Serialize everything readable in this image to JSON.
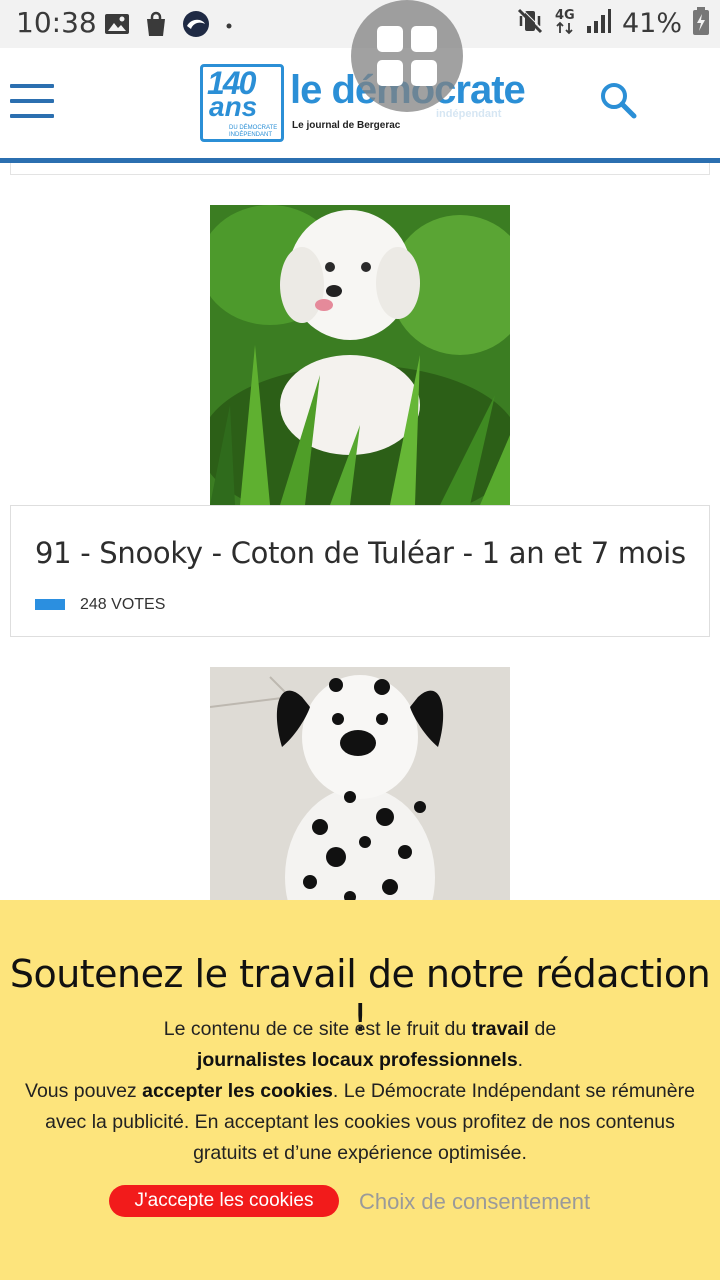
{
  "status_bar": {
    "time": "10:38",
    "battery_percent": "41%",
    "icons_left": [
      "image-icon",
      "shopping-bag-icon",
      "app-swirl-icon",
      "dot-icon"
    ],
    "icons_right": [
      "mute-vibrate-icon",
      "4g-icon",
      "signal-icon",
      "battery-charging-icon"
    ]
  },
  "header": {
    "logo_badge_number": "140",
    "logo_badge_word": "ans",
    "logo_badge_small": "DU DÉMOCRATE INDÉPENDANT",
    "logo_title": "le démocrate",
    "logo_subtitle": "Le journal de Bergerac",
    "logo_watermark": "indépendant",
    "accent_color": "#2b6fb0"
  },
  "entries": [
    {
      "title": "91 - Snooky - Coton de Tuléar - 1 an et 7 mois",
      "votes": "248 VOTES"
    }
  ],
  "cookie_banner": {
    "heading": "Soutenez le travail de notre rédaction !",
    "line1_a": "Le contenu de ce site est le fruit du ",
    "line1_b": "travail",
    "line1_c": " de",
    "line2_b": "journalistes locaux professionnels",
    "line2_c": ".",
    "line3_a": "Vous pouvez ",
    "line3_b": "accepter les cookies",
    "line3_c": ". Le Démocrate Indépendant se rémunère avec la publicité. En acceptant les cookies vous profitez de nos contenus gratuits et d’une expérience optimisée.",
    "accept_label": "J'accepte les cookies",
    "choice_label": "Choix de consentement",
    "background_color": "#fde47c",
    "accept_color": "#f21b1b"
  }
}
